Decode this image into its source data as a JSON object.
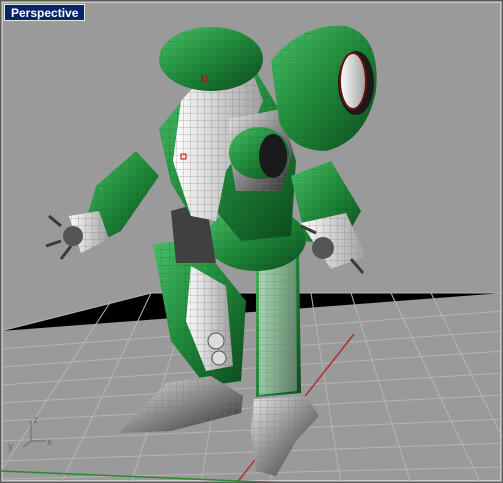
{
  "viewport": {
    "title": "Perspective",
    "background": "#9a9a9a",
    "grid_color": "#b4b4b4",
    "x_axis_color": "#b03030",
    "y_axis_color": "#2a8a2a",
    "model_color": "#1f8a3a"
  },
  "axis_widget": {
    "x_label": "x",
    "y_label": "y",
    "z_label": "z"
  }
}
